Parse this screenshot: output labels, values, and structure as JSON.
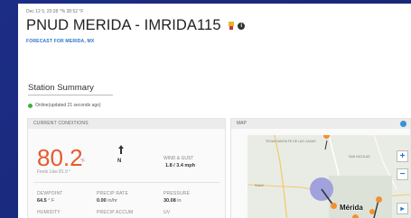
{
  "header": {
    "meta": "Dec 12 5, 20:28 °% 38:52 °F",
    "station_title": "PNUD MERIDA - IMRIDA115",
    "forecast_link": "FORECAST FOR MERIDA, MX",
    "icons": [
      "badge-icon",
      "info-icon"
    ]
  },
  "summary": {
    "title": "Station Summary",
    "status": "Online(updated 21 seconds ago)",
    "status_color": "#3cae48"
  },
  "current_conditions": {
    "header": "CURRENT CONDITIONS",
    "temperature": "80.2",
    "temp_unit": "°F",
    "feels_like": "Feels Like 81.9 °",
    "wind_direction": "N",
    "wind_label": "WIND & GUST",
    "wind_value": "1.8 / 3.4 mph",
    "dewpoint_label": "DEWPOINT",
    "dewpoint_value": "64.5",
    "dewpoint_unit": "° F",
    "precip_rate_label": "PRECIP RATE",
    "precip_rate_value": "0.00",
    "precip_rate_unit": "in/hr",
    "pressure_label": "PRESSURE",
    "pressure_value": "30.08",
    "pressure_unit": "in",
    "humidity_label": "HUMIDITY",
    "precip_accum_label": "PRECIP ACCUM",
    "uv_label": "UV",
    "accent_color": "#e8592e"
  },
  "map": {
    "header": "MAP",
    "places": [
      "TEXAN SANTA FE DE LAS CASAS",
      "SAN NICOLAS",
      "Sodzil"
    ],
    "city_label": "Mérida",
    "zoom_in": "+",
    "zoom_out": "−",
    "play": "▸",
    "marker_color": "#f0922e",
    "halo_color": "#9d9ddc"
  }
}
